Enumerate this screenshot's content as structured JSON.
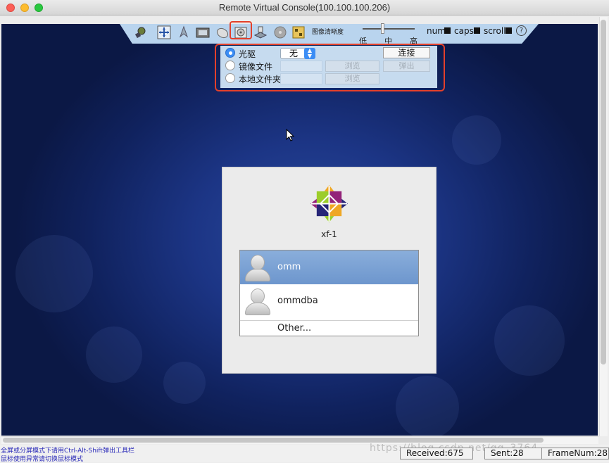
{
  "window": {
    "title": "Remote Virtual Console(100.100.100.206)"
  },
  "toolbar": {
    "icons": [
      "keyboard-icon",
      "mouse-move-icon",
      "power-icon",
      "screenshot-icon",
      "mouse-icon",
      "cd-drive-icon",
      "floppy-icon",
      "disk-icon",
      "config-icon"
    ],
    "image_quality_label": "图像清晰度",
    "quality_levels": [
      "低",
      "中",
      "高"
    ],
    "quality_value": "中",
    "locks": [
      {
        "label": "num",
        "on": true
      },
      {
        "label": "caps",
        "on": true
      },
      {
        "label": "scroll",
        "on": true
      }
    ],
    "help_label": "?"
  },
  "media_panel": {
    "options": [
      {
        "label": "光驱",
        "selected": true
      },
      {
        "label": "镜像文件",
        "selected": false
      },
      {
        "label": "本地文件夹",
        "selected": false
      }
    ],
    "drive_value": "无",
    "connect_label": "连接",
    "eject_label": "弹出",
    "browse_label_1": "浏览",
    "browse_label_2": "浏览"
  },
  "login": {
    "hostname": "xf-1",
    "users": [
      {
        "name": "omm",
        "selected": true
      },
      {
        "name": "ommdba",
        "selected": false
      }
    ],
    "other_label": "Other..."
  },
  "status": {
    "hint_line_1": "全屏或分屏模式下请用Ctrl-Alt-Shift弹出工具栏",
    "hint_line_2": "鼠标使用异常请切换鼠标模式",
    "received": "Received:675",
    "sent": "Sent:28",
    "frame_num": "FrameNum:28",
    "watermark": "https://blog.csdn.net/qq_3764..."
  },
  "colors": {
    "toolbar_bg": "#b9d4ee",
    "highlight_red": "#e3402b",
    "desktop_blue": "#1c3585",
    "selection_blue": "#7aa0d4"
  }
}
